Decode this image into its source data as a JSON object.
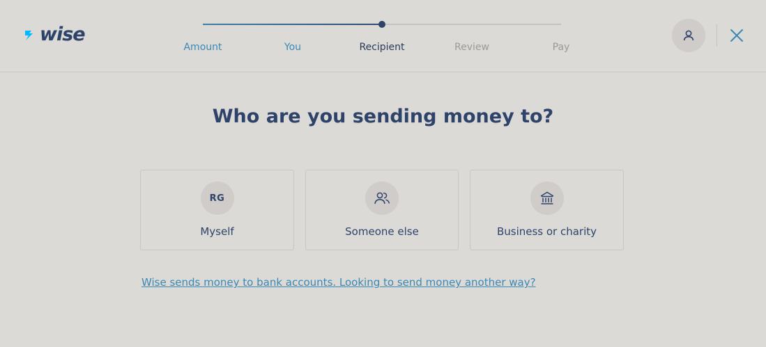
{
  "brand": {
    "logo_text": "wise",
    "logo_icon": "wise-flag-icon",
    "color_navy": "#2e4369",
    "color_link": "#3a88b4"
  },
  "stepper": {
    "steps": [
      {
        "label": "Amount",
        "state": "done"
      },
      {
        "label": "You",
        "state": "done"
      },
      {
        "label": "Recipient",
        "state": "current"
      },
      {
        "label": "Review",
        "state": "todo"
      },
      {
        "label": "Pay",
        "state": "todo"
      }
    ],
    "current_index": 2
  },
  "header": {
    "account_icon": "user-icon",
    "close_icon": "close-icon"
  },
  "main": {
    "title": "Who are you sending money to?",
    "options": [
      {
        "label": "Myself",
        "initials": "RG",
        "icon": "initials-avatar"
      },
      {
        "label": "Someone else",
        "icon": "people-icon"
      },
      {
        "label": "Business or charity",
        "icon": "bank-icon"
      }
    ],
    "help_link": "Wise sends money to bank accounts. Looking to send money another way?"
  }
}
